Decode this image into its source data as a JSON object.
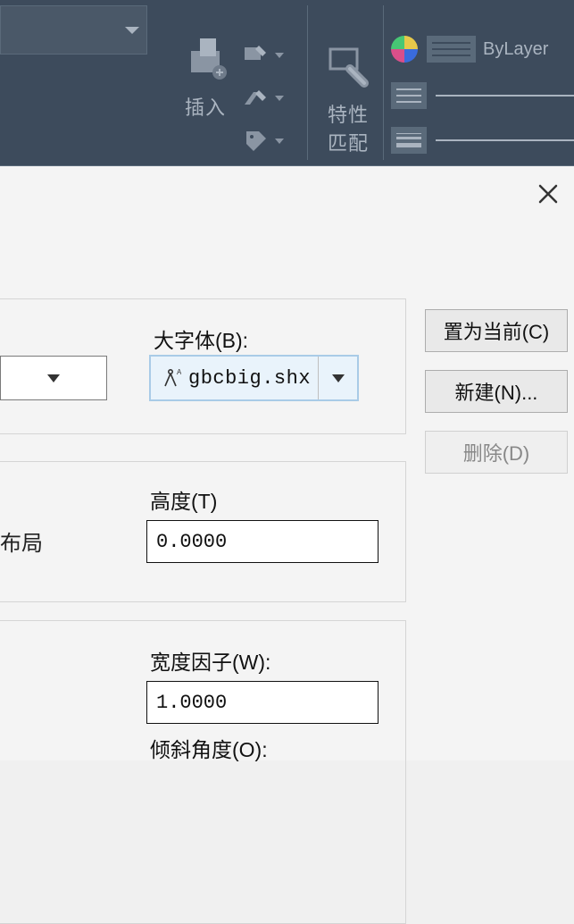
{
  "ribbon": {
    "insert_label": "插入",
    "properties_match_label": "特性\n匹配",
    "bylayer_label": "ByLayer"
  },
  "dialog": {
    "big_font_label": "大字体(B):",
    "big_font_value": "gbcbig.shx",
    "height_label": "高度(T)",
    "height_value": "0.0000",
    "layout_text": "布局",
    "width_factor_label": "宽度因子(W):",
    "width_factor_value": "1.0000",
    "oblique_label": "倾斜角度(O):"
  },
  "buttons": {
    "set_current": "置为当前(C)",
    "new": "新建(N)...",
    "delete": "删除(D)"
  }
}
